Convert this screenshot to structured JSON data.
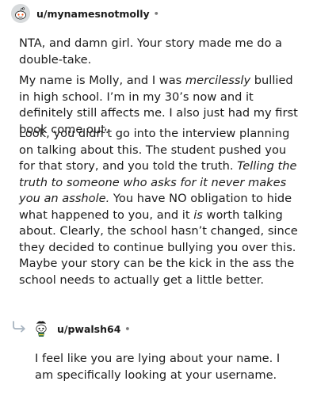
{
  "comment1": {
    "username": "u/mynamesnotmolly",
    "separator": "•",
    "paragraph1": "NTA, and damn girl. Your story made me do a double-take.",
    "paragraph2": {
      "part1": "My name is Molly, and I was ",
      "emphasis": "mercilessly",
      "part2": " bullied in high school. I’m in my 30’s now and it definitely still affects me. I also just had my first book come out."
    },
    "paragraph3": {
      "part1": "Look, you didn’t go into the interview planning on talking about this. The student pushed you for that story, and you told the truth. ",
      "emphasis1": "Telling the truth to someone who asks for it never makes you an asshole.",
      "part2": " You have NO obligation to hide what happened to you, and it ",
      "emphasis2": "is",
      "part3": " worth talking about. Clearly, the school hasn’t changed, since they decided to continue bullying you over this. Maybe your story can be the kick in the ass the school needs to actually get a little better."
    }
  },
  "comment2": {
    "username": "u/pwalsh64",
    "separator": "•",
    "avatar_icon": "snoo-avatar-icon",
    "reply_icon": "reply-arrow-icon",
    "paragraph1": "I feel like you are lying about your name. I am specifically looking at your username."
  },
  "colors": {
    "text": "#1c1c1c",
    "meta": "#7c7c7c",
    "reply_arrow": "#a8b4c0"
  }
}
